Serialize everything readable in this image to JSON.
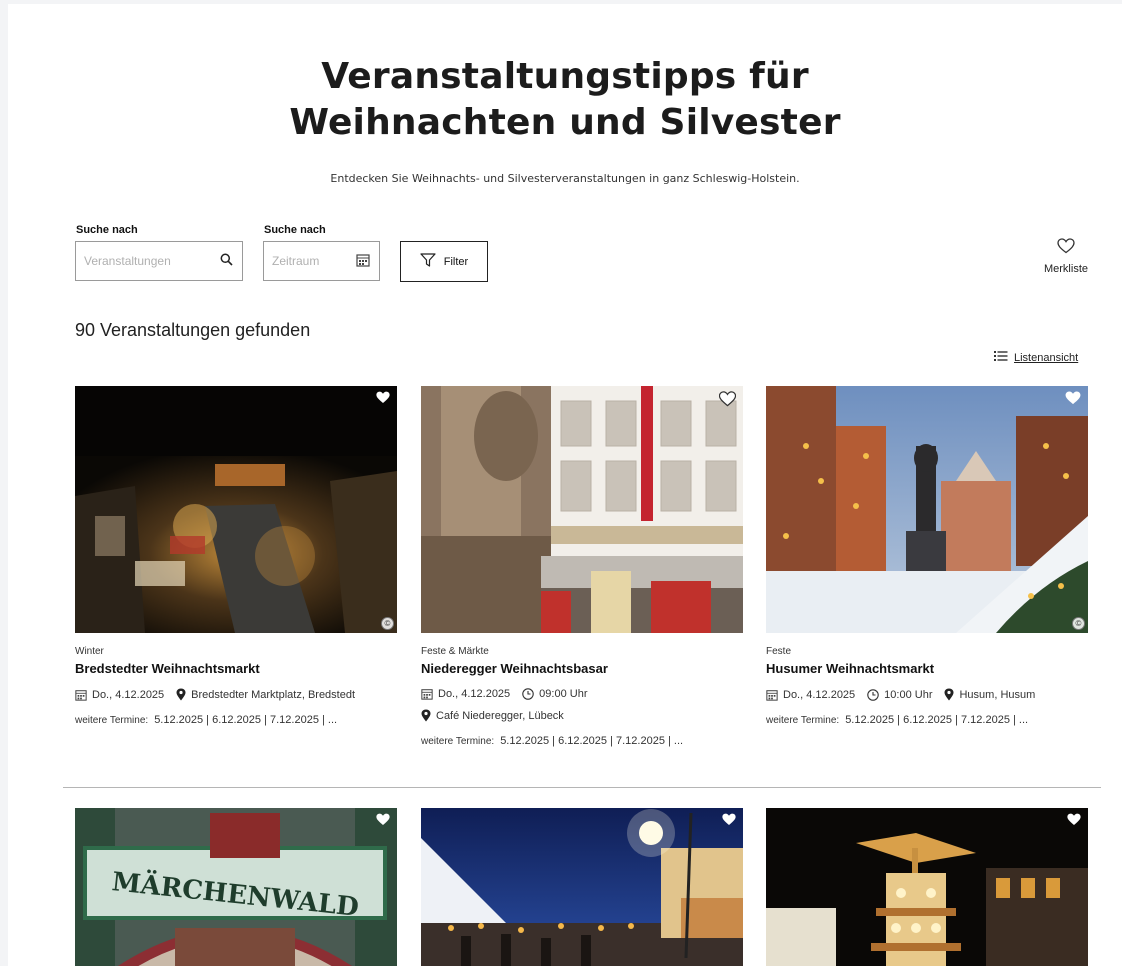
{
  "hero": {
    "title_line1": "Veranstaltungstipps für",
    "title_line2": "Weihnachten und Silvester",
    "subtitle": "Entdecken Sie Weihnachts- und Silvesterveranstaltungen in ganz Schleswig-Holstein."
  },
  "search": {
    "events_label": "Suche nach",
    "events_placeholder": "Veranstaltungen",
    "period_label": "Suche nach",
    "period_placeholder": "Zeitraum",
    "filter_label": "Filter",
    "favorites_label": "Merkliste"
  },
  "results": {
    "count_text": "90 Veranstaltungen gefunden",
    "list_view_label": "Listenansicht"
  },
  "cards": [
    {
      "category": "Winter",
      "title": "Bredstedter Weihnachtsmarkt",
      "date": "Do., 4.12.2025",
      "location": "Bredstedter Marktplatz, Bredstedt",
      "more_label": "weitere Termine:",
      "more_dates": "5.12.2025 | 6.12.2025 | 7.12.2025 | ..."
    },
    {
      "category": "Feste & Märkte",
      "title": "Niederegger Weihnachtsbasar",
      "date": "Do., 4.12.2025",
      "time": "09:00 Uhr",
      "location": "Café Niederegger, Lübeck",
      "more_label": "weitere Termine:",
      "more_dates": "5.12.2025 | 6.12.2025 | 7.12.2025 | ..."
    },
    {
      "category": "Feste",
      "title": "Husumer Weihnachtsmarkt",
      "date": "Do., 4.12.2025",
      "time": "10:00 Uhr",
      "location": "Husum, Husum",
      "more_label": "weitere Termine:",
      "more_dates": "5.12.2025 | 6.12.2025 | 7.12.2025 | ..."
    }
  ],
  "images": {
    "card4_sign_text": "MÄRCHENWALD"
  },
  "colors": {
    "text": "#1c1c1c",
    "border": "#9a9a9a",
    "divider": "#b5b5b5"
  }
}
